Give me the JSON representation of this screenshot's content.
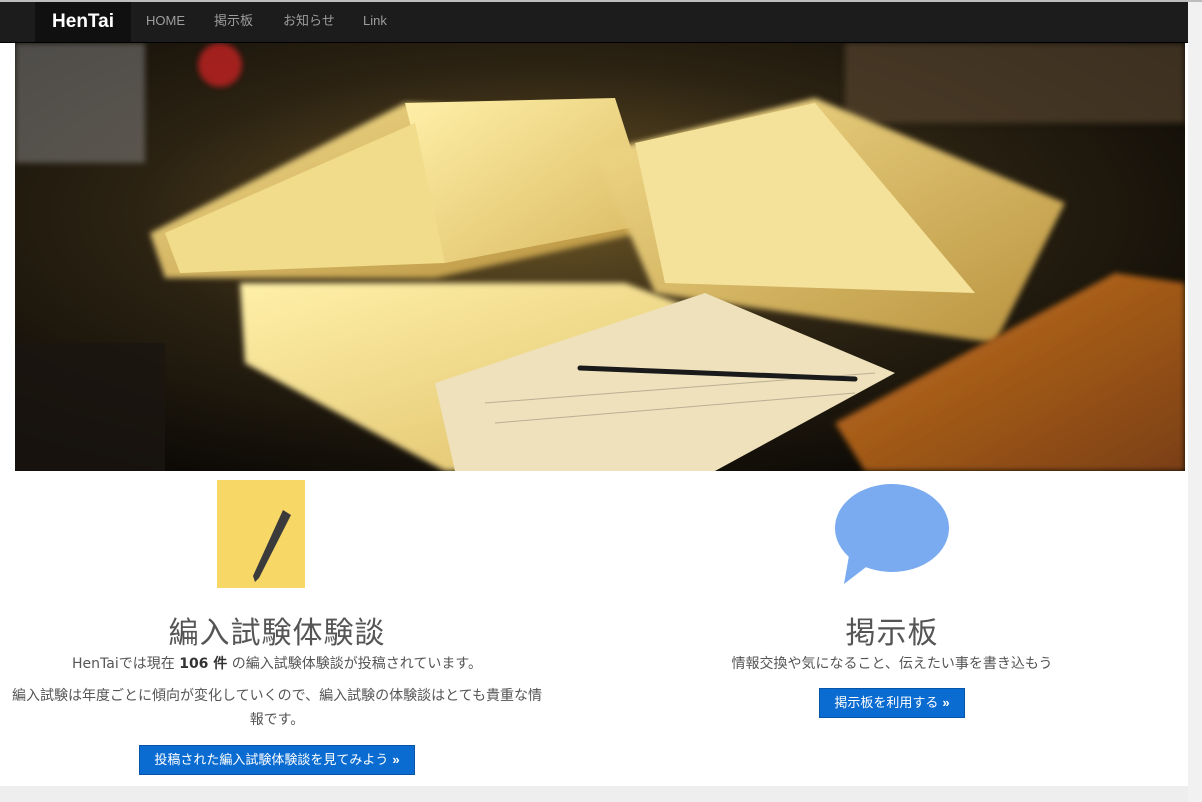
{
  "nav": {
    "brand": "HenTai",
    "items": [
      "HOME",
      "掲示板",
      "お知らせ",
      "Link"
    ]
  },
  "left": {
    "icon": "pencil-icon",
    "title": "編入試験体験談",
    "intro_before": "HenTaiでは現在 ",
    "count": "106 件",
    "intro_after": " の編入試験体験談が投稿されています。",
    "desc_line1": "編入試験は年度ごとに傾向が変化していくので、編入試験の体験談はとても貴重な情",
    "desc_line2": "報です。",
    "button": "投稿された編入試験体験談を見てみよう",
    "button_arrow": "»"
  },
  "right": {
    "icon": "speech-bubble-icon",
    "title": "掲示板",
    "desc": "情報交換や気になること、伝えたい事を書き込もう",
    "button": "掲示板を利用する",
    "button_arrow": "»"
  },
  "colors": {
    "navbar": "#1c1c1c",
    "brand_bg": "#101010",
    "pencil_tile": "#f7d866",
    "bubble": "#7aaaf0",
    "button": "#0a6bd1"
  }
}
